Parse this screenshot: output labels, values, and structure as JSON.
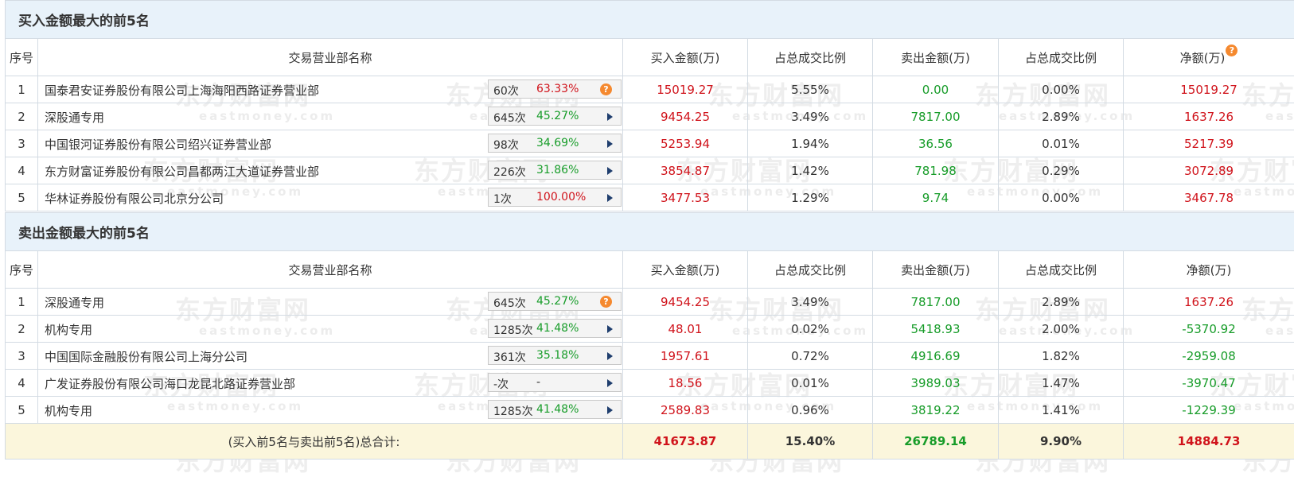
{
  "buy_section": {
    "title": "买入金额最大的前5名",
    "headers": [
      "序号",
      "交易营业部名称",
      "买入金额(万)",
      "占总成交比例",
      "卖出金额(万)",
      "占总成交比例",
      "净额(万)"
    ],
    "rows": [
      {
        "idx": "1",
        "name": "国泰君安证券股份有限公司上海海阳西路证券营业部",
        "count": "60次",
        "pct": "63.33%",
        "icon": "question-icon",
        "buy": "15019.27",
        "buy_ratio": "5.55%",
        "sell": "0.00",
        "sell_ratio": "0.00%",
        "net": "15019.27"
      },
      {
        "idx": "2",
        "name": "深股通专用",
        "count": "645次",
        "pct": "45.27%",
        "icon": "arrow-right-icon",
        "buy": "9454.25",
        "buy_ratio": "3.49%",
        "sell": "7817.00",
        "sell_ratio": "2.89%",
        "net": "1637.26"
      },
      {
        "idx": "3",
        "name": "中国银河证券股份有限公司绍兴证券营业部",
        "count": "98次",
        "pct": "34.69%",
        "icon": "arrow-right-icon",
        "buy": "5253.94",
        "buy_ratio": "1.94%",
        "sell": "36.56",
        "sell_ratio": "0.01%",
        "net": "5217.39"
      },
      {
        "idx": "4",
        "name": "东方财富证券股份有限公司昌都两江大道证券营业部",
        "count": "226次",
        "pct": "31.86%",
        "icon": "arrow-right-icon",
        "buy": "3854.87",
        "buy_ratio": "1.42%",
        "sell": "781.98",
        "sell_ratio": "0.29%",
        "net": "3072.89"
      },
      {
        "idx": "5",
        "name": "华林证券股份有限公司北京分公司",
        "count": "1次",
        "pct": "100.00%",
        "icon": "arrow-right-icon",
        "buy": "3477.53",
        "buy_ratio": "1.29%",
        "sell": "9.74",
        "sell_ratio": "0.00%",
        "net": "3467.78"
      }
    ]
  },
  "sell_section": {
    "title": "卖出金额最大的前5名",
    "headers": [
      "序号",
      "交易营业部名称",
      "买入金额(万)",
      "占总成交比例",
      "卖出金额(万)",
      "占总成交比例",
      "净额(万)"
    ],
    "rows": [
      {
        "idx": "1",
        "name": "深股通专用",
        "count": "645次",
        "pct": "45.27%",
        "icon": "question-icon",
        "buy": "9454.25",
        "buy_ratio": "3.49%",
        "sell": "7817.00",
        "sell_ratio": "2.89%",
        "net": "1637.26"
      },
      {
        "idx": "2",
        "name": "机构专用",
        "count": "1285次",
        "pct": "41.48%",
        "icon": "arrow-right-icon",
        "buy": "48.01",
        "buy_ratio": "0.02%",
        "sell": "5418.93",
        "sell_ratio": "2.00%",
        "net": "-5370.92"
      },
      {
        "idx": "3",
        "name": "中国国际金融股份有限公司上海分公司",
        "count": "361次",
        "pct": "35.18%",
        "icon": "arrow-right-icon",
        "buy": "1957.61",
        "buy_ratio": "0.72%",
        "sell": "4916.69",
        "sell_ratio": "1.82%",
        "net": "-2959.08"
      },
      {
        "idx": "4",
        "name": "广发证券股份有限公司海口龙昆北路证券营业部",
        "count": "-次",
        "pct": "-",
        "icon": "arrow-right-icon",
        "buy": "18.56",
        "buy_ratio": "0.01%",
        "sell": "3989.03",
        "sell_ratio": "1.47%",
        "net": "-3970.47"
      },
      {
        "idx": "5",
        "name": "机构专用",
        "count": "1285次",
        "pct": "41.48%",
        "icon": "arrow-right-icon",
        "buy": "2589.83",
        "buy_ratio": "0.96%",
        "sell": "3819.22",
        "sell_ratio": "1.41%",
        "net": "-1229.39"
      }
    ]
  },
  "total": {
    "label": "(买入前5名与卖出前5名)总合计:",
    "buy": "41673.87",
    "buy_ratio": "15.40%",
    "sell": "26789.14",
    "sell_ratio": "9.90%",
    "net": "14884.73"
  },
  "question_glyph": "?",
  "watermark": {
    "cn": "东方财富网",
    "en": "eastmoney.com"
  },
  "colors": {
    "red": "#d0131b",
    "green": "#179c29",
    "title_bg": "#e8f2fa",
    "total_bg": "#fbf6dc",
    "icon_orange": "#f5892f"
  }
}
